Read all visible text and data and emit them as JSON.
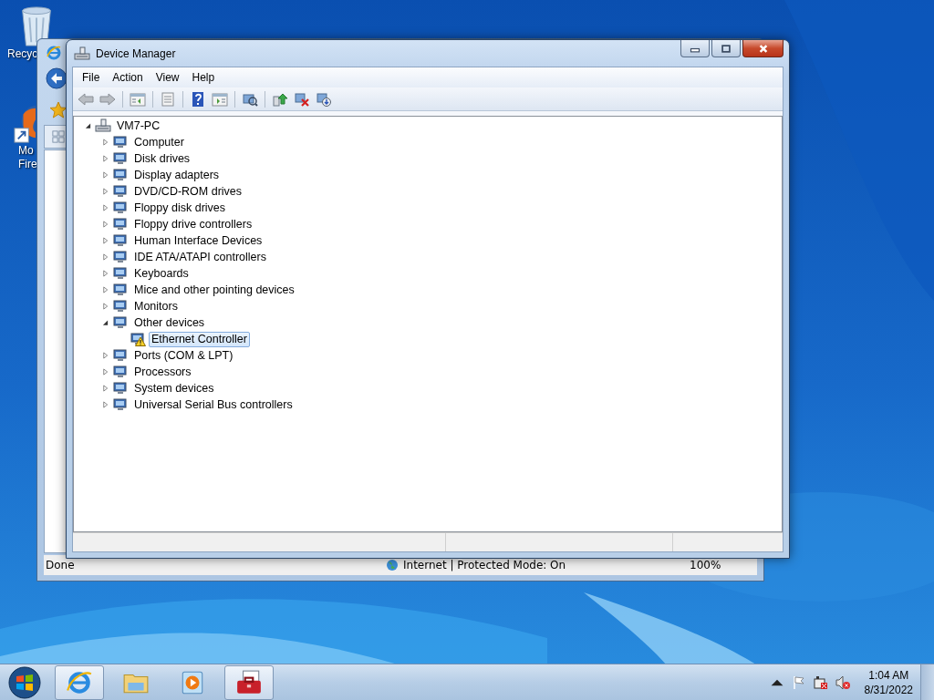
{
  "desktop_icons": [
    {
      "kind": "recycle-bin",
      "label_lines": [
        "Recyc"
      ]
    },
    {
      "kind": "browser-shortcut",
      "label_lines": [
        "Mo",
        "Fire"
      ]
    }
  ],
  "browser_window": {
    "status": "Done",
    "zone": "Internet | Protected Mode: On",
    "zoom": "100%"
  },
  "device_manager": {
    "title": "Device Manager",
    "menu": [
      "File",
      "Action",
      "View",
      "Help"
    ],
    "tree": {
      "label": "VM7-PC",
      "expanded": true,
      "selected": false,
      "children": [
        {
          "label": "Computer",
          "expanded": false,
          "selected": false
        },
        {
          "label": "Disk drives",
          "expanded": false,
          "selected": false
        },
        {
          "label": "Display adapters",
          "expanded": false,
          "selected": false
        },
        {
          "label": "DVD/CD-ROM drives",
          "expanded": false,
          "selected": false
        },
        {
          "label": "Floppy disk drives",
          "expanded": false,
          "selected": false
        },
        {
          "label": "Floppy drive controllers",
          "expanded": false,
          "selected": false
        },
        {
          "label": "Human Interface Devices",
          "expanded": false,
          "selected": false
        },
        {
          "label": "IDE ATA/ATAPI controllers",
          "expanded": false,
          "selected": false
        },
        {
          "label": "Keyboards",
          "expanded": false,
          "selected": false
        },
        {
          "label": "Mice and other pointing devices",
          "expanded": false,
          "selected": false
        },
        {
          "label": "Monitors",
          "expanded": false,
          "selected": false
        },
        {
          "label": "Other devices",
          "expanded": true,
          "selected": false,
          "children": [
            {
              "label": "Ethernet Controller",
              "selected": true,
              "warning": true
            }
          ]
        },
        {
          "label": "Ports (COM & LPT)",
          "expanded": false,
          "selected": false
        },
        {
          "label": "Processors",
          "expanded": false,
          "selected": false
        },
        {
          "label": "System devices",
          "expanded": false,
          "selected": false
        },
        {
          "label": "Universal Serial Bus controllers",
          "expanded": false,
          "selected": false
        }
      ]
    }
  },
  "taskbar": {
    "items": [
      {
        "kind": "browser",
        "open": true
      },
      {
        "kind": "folder",
        "open": false
      },
      {
        "kind": "media",
        "open": false
      },
      {
        "kind": "toolbox",
        "open": true
      }
    ],
    "clock": {
      "time": "1:04 AM",
      "date": "8/31/2022"
    }
  }
}
